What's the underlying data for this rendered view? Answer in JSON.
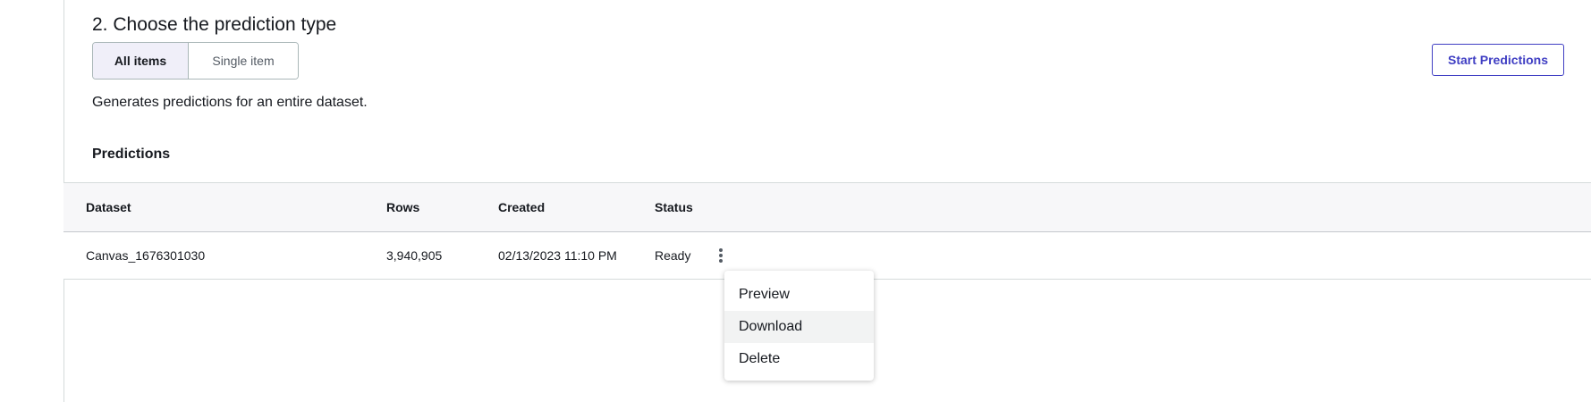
{
  "section": {
    "title": "2. Choose the prediction type",
    "description": "Generates predictions for an entire dataset."
  },
  "prediction_type": {
    "options": [
      "All items",
      "Single item"
    ],
    "selected": "All items"
  },
  "actions": {
    "start_label": "Start Predictions"
  },
  "predictions": {
    "heading": "Predictions",
    "columns": [
      "Dataset",
      "Rows",
      "Created",
      "Status"
    ],
    "rows": [
      {
        "dataset": "Canvas_1676301030",
        "rows": "3,940,905",
        "created": "02/13/2023 11:10 PM",
        "status": "Ready"
      }
    ]
  },
  "row_menu": {
    "items": [
      "Preview",
      "Download",
      "Delete"
    ],
    "highlighted": "Download"
  },
  "colors": {
    "accent": "#3f3ec3",
    "selected_segment_bg": "#f0eff9",
    "header_bg": "#f7f7f9"
  },
  "icons": {
    "row_actions": "more-vertical-icon"
  }
}
